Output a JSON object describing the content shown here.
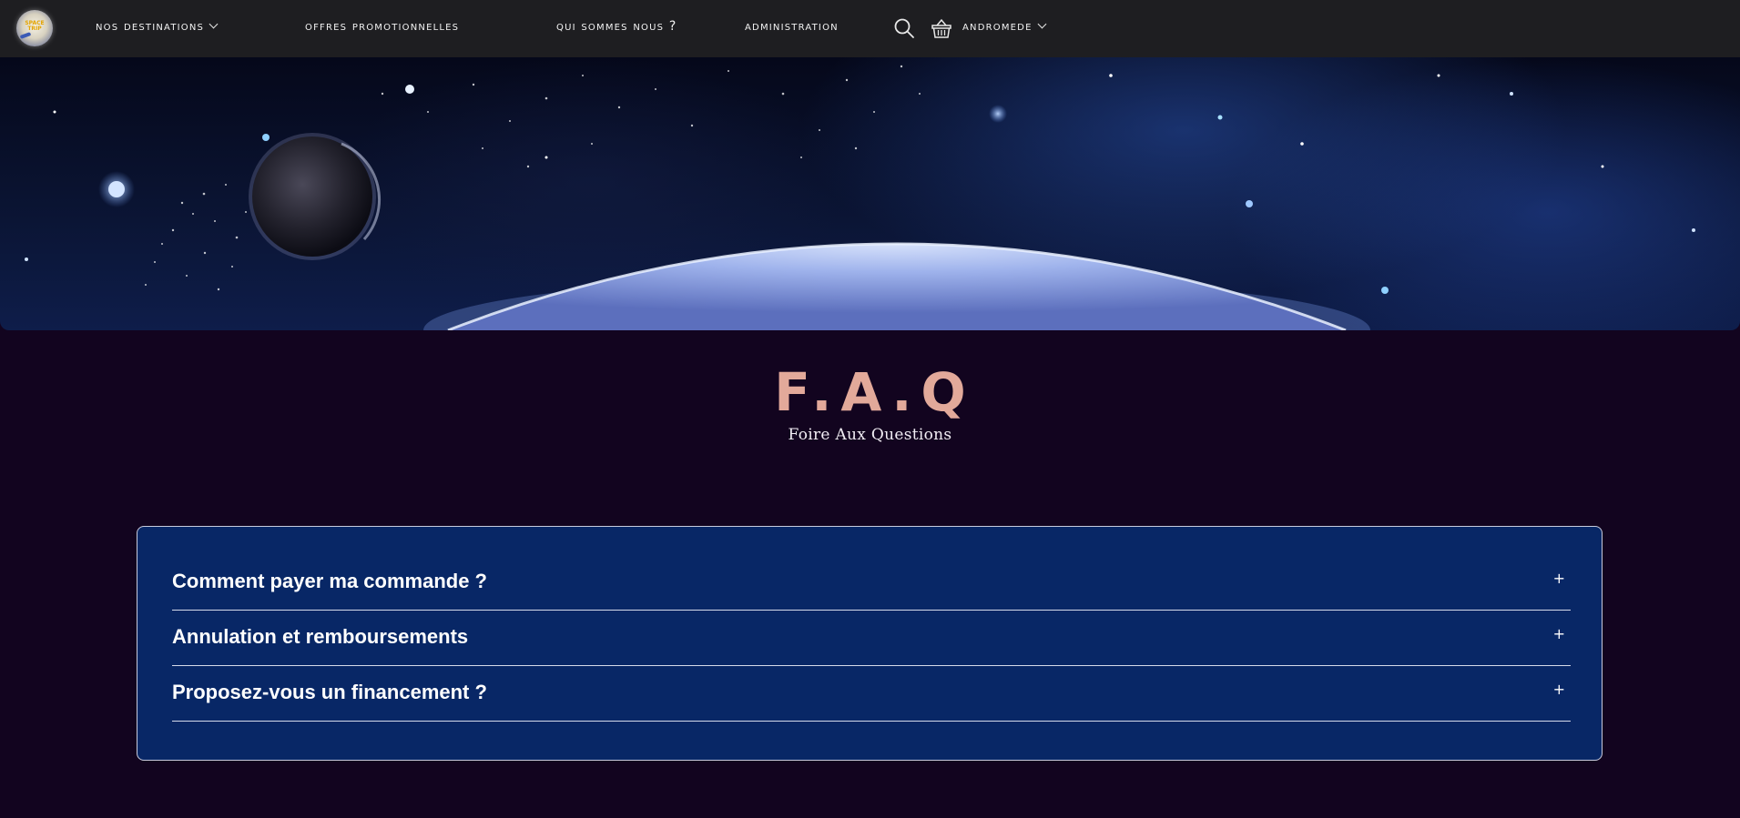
{
  "nav": {
    "logo_text": "SPACE TRIP",
    "items": [
      {
        "label": "NOS DESTINATIONS",
        "dropdown": true
      },
      {
        "label": "OFFRES PROMOTIONNELLES",
        "dropdown": false
      },
      {
        "label": "QUI SOMMES NOUS ?",
        "dropdown": false
      },
      {
        "label": "ADMINISTRATION",
        "dropdown": false
      }
    ],
    "search_icon": "search-icon",
    "cart_icon": "basket-icon",
    "user_label": "ANDROMEDE"
  },
  "faq": {
    "title": "F.A.Q",
    "subtitle": "Foire Aux Questions",
    "items": [
      {
        "question": "Comment payer ma commande ?",
        "toggle": "+"
      },
      {
        "question": "Annulation et remboursements",
        "toggle": "+"
      },
      {
        "question": "Proposez-vous un financement ?",
        "toggle": "+"
      }
    ]
  },
  "colors": {
    "page_background": "#12041f",
    "nav_background": "#1e1e21",
    "faq_title": "#e2a99a",
    "faq_panel": "#082766"
  }
}
